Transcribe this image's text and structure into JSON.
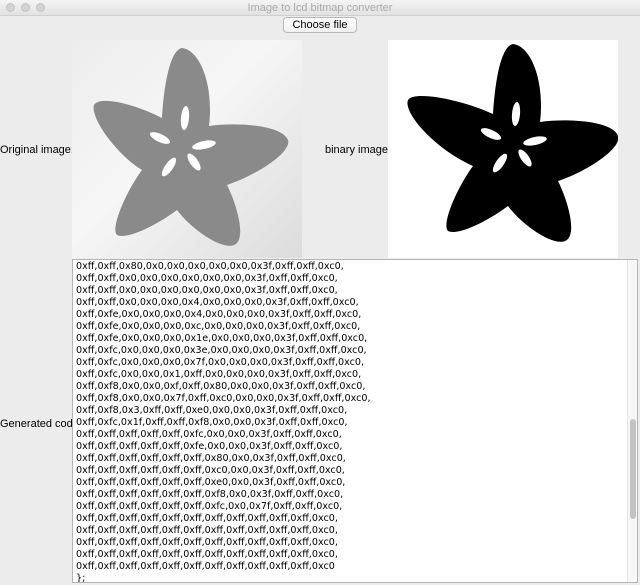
{
  "window": {
    "title": "Image to lcd bitmap converter"
  },
  "toolbar": {
    "choose_file_label": "Choose file"
  },
  "labels": {
    "original_image": "Original image:",
    "binary_image": "binary image:",
    "generated_code": "Generated code:"
  },
  "colors": {
    "original_flower": "#8a8a8a",
    "binary_flower": "#000000",
    "flower_petal_marks": "#ffffff"
  },
  "code": {
    "lines": [
      "0xff,0xff,0x80,0x0,0x0,0x0,0x0,0x0,0x3f,0xff,0xff,0xc0,",
      "0xff,0xff,0x0,0x0,0x0,0x0,0x0,0x0,0x3f,0xff,0xff,0xc0,",
      "0xff,0xff,0x0,0x0,0x0,0x0,0x0,0x0,0x3f,0xff,0xff,0xc0,",
      "0xff,0xff,0x0,0x0,0x0,0x4,0x0,0x0,0x0,0x3f,0xff,0xff,0xc0,",
      "0xff,0xfe,0x0,0x0,0x0,0x4,0x0,0x0,0x0,0x3f,0xff,0xff,0xc0,",
      "0xff,0xfe,0x0,0x0,0x0,0xc,0x0,0x0,0x0,0x3f,0xff,0xff,0xc0,",
      "0xff,0xfe,0x0,0x0,0x0,0x1e,0x0,0x0,0x0,0x3f,0xff,0xff,0xc0,",
      "0xff,0xfc,0x0,0x0,0x0,0x3e,0x0,0x0,0x0,0x3f,0xff,0xff,0xc0,",
      "0xff,0xfc,0x0,0x0,0x0,0x7f,0x0,0x0,0x0,0x3f,0xff,0xff,0xc0,",
      "0xff,0xfc,0x0,0x0,0x1,0xff,0x0,0x0,0x0,0x3f,0xff,0xff,0xc0,",
      "0xff,0xf8,0x0,0x0,0xf,0xff,0x80,0x0,0x0,0x3f,0xff,0xff,0xc0,",
      "0xff,0xf8,0x0,0x0,0x7f,0xff,0xc0,0x0,0x0,0x3f,0xff,0xff,0xc0,",
      "0xff,0xf8,0x3,0xff,0xff,0xe0,0x0,0x0,0x3f,0xff,0xff,0xc0,",
      "0xff,0xfc,0x1f,0xff,0xff,0xf8,0x0,0x0,0x3f,0xff,0xff,0xc0,",
      "0xff,0xff,0xff,0xff,0xff,0xfc,0x0,0x0,0x3f,0xff,0xff,0xc0,",
      "0xff,0xff,0xff,0xff,0xff,0xfe,0x0,0x0,0x3f,0xff,0xff,0xc0,",
      "0xff,0xff,0xff,0xff,0xff,0xff,0x80,0x0,0x3f,0xff,0xff,0xc0,",
      "0xff,0xff,0xff,0xff,0xff,0xff,0xc0,0x0,0x3f,0xff,0xff,0xc0,",
      "0xff,0xff,0xff,0xff,0xff,0xff,0xe0,0x0,0x3f,0xff,0xff,0xc0,",
      "0xff,0xff,0xff,0xff,0xff,0xff,0xf8,0x0,0x3f,0xff,0xff,0xc0,",
      "0xff,0xff,0xff,0xff,0xff,0xff,0xfc,0x0,0x7f,0xff,0xff,0xc0,",
      "0xff,0xff,0xff,0xff,0xff,0xff,0xff,0xff,0xff,0xff,0xff,0xc0,",
      "0xff,0xff,0xff,0xff,0xff,0xff,0xff,0xff,0xff,0xff,0xff,0xc0,",
      "0xff,0xff,0xff,0xff,0xff,0xff,0xff,0xff,0xff,0xff,0xff,0xc0,",
      "0xff,0xff,0xff,0xff,0xff,0xff,0xff,0xff,0xff,0xff,0xff,0xc0,",
      "0xff,0xff,0xff,0xff,0xff,0xff,0xff,0xff,0xff,0xff,0xff,0xc0",
      "};"
    ]
  },
  "scroll": {
    "position_fraction": 0.68,
    "visible_fraction": 0.31
  }
}
